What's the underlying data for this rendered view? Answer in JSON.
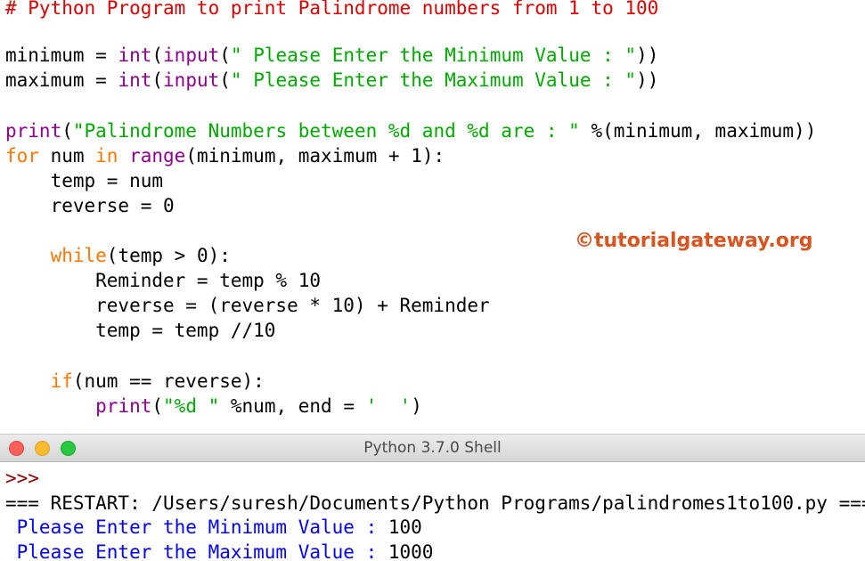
{
  "editor": {
    "comment": "# Python Program to print Palindrome numbers from 1 to 100",
    "l_min_var": "minimum = ",
    "l_min_int": "int",
    "l_min_paren1": "(",
    "l_min_input": "input",
    "l_min_paren2": "(",
    "l_min_str": "\" Please Enter the Minimum Value : \"",
    "l_min_close": "))",
    "l_max_var": "maximum = ",
    "l_max_int": "int",
    "l_max_paren1": "(",
    "l_max_input": "input",
    "l_max_paren2": "(",
    "l_max_str": "\" Please Enter the Maximum Value : \"",
    "l_max_close": "))",
    "l_print": "print",
    "l_print_paren": "(",
    "l_print_str": "\"Palindrome Numbers between %d and %d are : \"",
    "l_print_rest": " %(minimum, maximum))",
    "l_for": "for",
    "l_for_mid": " num ",
    "l_in": "in",
    "l_sp": " ",
    "l_range": "range",
    "l_range_rest": "(minimum, maximum + 1):",
    "l_temp": "    temp = num",
    "l_reverse": "    reverse = 0",
    "l_while_indent": "    ",
    "l_while": "while",
    "l_while_rest": "(temp > 0):",
    "l_reminder": "        Reminder = temp % 10",
    "l_rev_calc": "        reverse = (reverse * 10) + Reminder",
    "l_temp_div": "        temp = temp //10",
    "l_if_indent": "    ",
    "l_if": "if",
    "l_if_rest": "(num == reverse):",
    "l_p2_indent": "        ",
    "l_p2_print": "print",
    "l_p2_paren": "(",
    "l_p2_str": "\"%d \"",
    "l_p2_mid": " %num, end = ",
    "l_p2_str2": "'  '",
    "l_p2_close": ")"
  },
  "watermark": "©tutorialgateway.org",
  "shell_window": {
    "title": "Python 3.7.0 Shell"
  },
  "shell": {
    "prompt": ">>>",
    "restart": "=== RESTART: /Users/suresh/Documents/Python Programs/palindromes1to100.py ===",
    "min_label": " Please Enter the Minimum Value : ",
    "min_value": "100",
    "max_label": " Please Enter the Maximum Value : ",
    "max_value": "1000"
  },
  "colors": {
    "keyword": "#ff7700",
    "builtin": "#900090",
    "string": "#00aa00",
    "comment": "#dd0000",
    "shell_output": "#0000ff",
    "watermark": "#d9541e"
  }
}
